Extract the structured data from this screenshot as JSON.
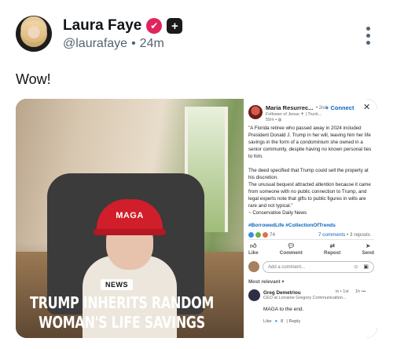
{
  "author": {
    "display_name": "Laura Faye",
    "handle": "@laurafaye",
    "separator": "•",
    "time": "24m",
    "verified_icon": "verified-badge-icon",
    "plus_icon": "plus-badge-icon",
    "colors": {
      "verified": "#e0245e",
      "plus": "#1a1a1a"
    }
  },
  "post": {
    "text": "Wow!"
  },
  "image": {
    "hat_text": "MAGA",
    "news_tag": "NEWS",
    "headline_line1": "TRUMP INHERITS RANDOM",
    "headline_line2": "WOMAN'S LIFE SAVINGS"
  },
  "linkedin": {
    "name": "Maria Resurrec...",
    "degree": "• 2nd",
    "connect": "+ Connect",
    "close": "✕",
    "subtitle": "Follower of Jesus ✝ | Truck...",
    "time": "55m • ◍",
    "body": "\"A Florida retiree who passed away in 2024 included President Donald J. Trump in her will, leaving him her life savings in the form of a condominium she owned in a senior community, despite having no known personal ties to him.\n\nThe deed specified that Trump could sell the property at his discretion.\nThe unusual bequest attracted attention because it came from someone with no public connection to Trump, and legal experts note that gifts to public figures in wills are rare and not typical.\"\n~ Conservative Daily News",
    "hashtags": "#BorrowedLife #CollectionOfTrends",
    "reaction_count": "74",
    "comments": "7 comments",
    "reposts": "• 3 reposts",
    "actions": {
      "like": "Like",
      "comment": "Comment",
      "repost": "Repost",
      "send": "Send"
    },
    "comment_placeholder": "Add a comment...",
    "most_relevant": "Most relevant ▾",
    "commenter": {
      "name": "Greg Demetriou",
      "meta": "in • 1st",
      "time": "1h  •••",
      "title": "CEO at Lorraine Gregory Communication...",
      "text": "MAGA to the end.",
      "like": "Like",
      "like_count": "8",
      "reply": "| Reply"
    }
  }
}
